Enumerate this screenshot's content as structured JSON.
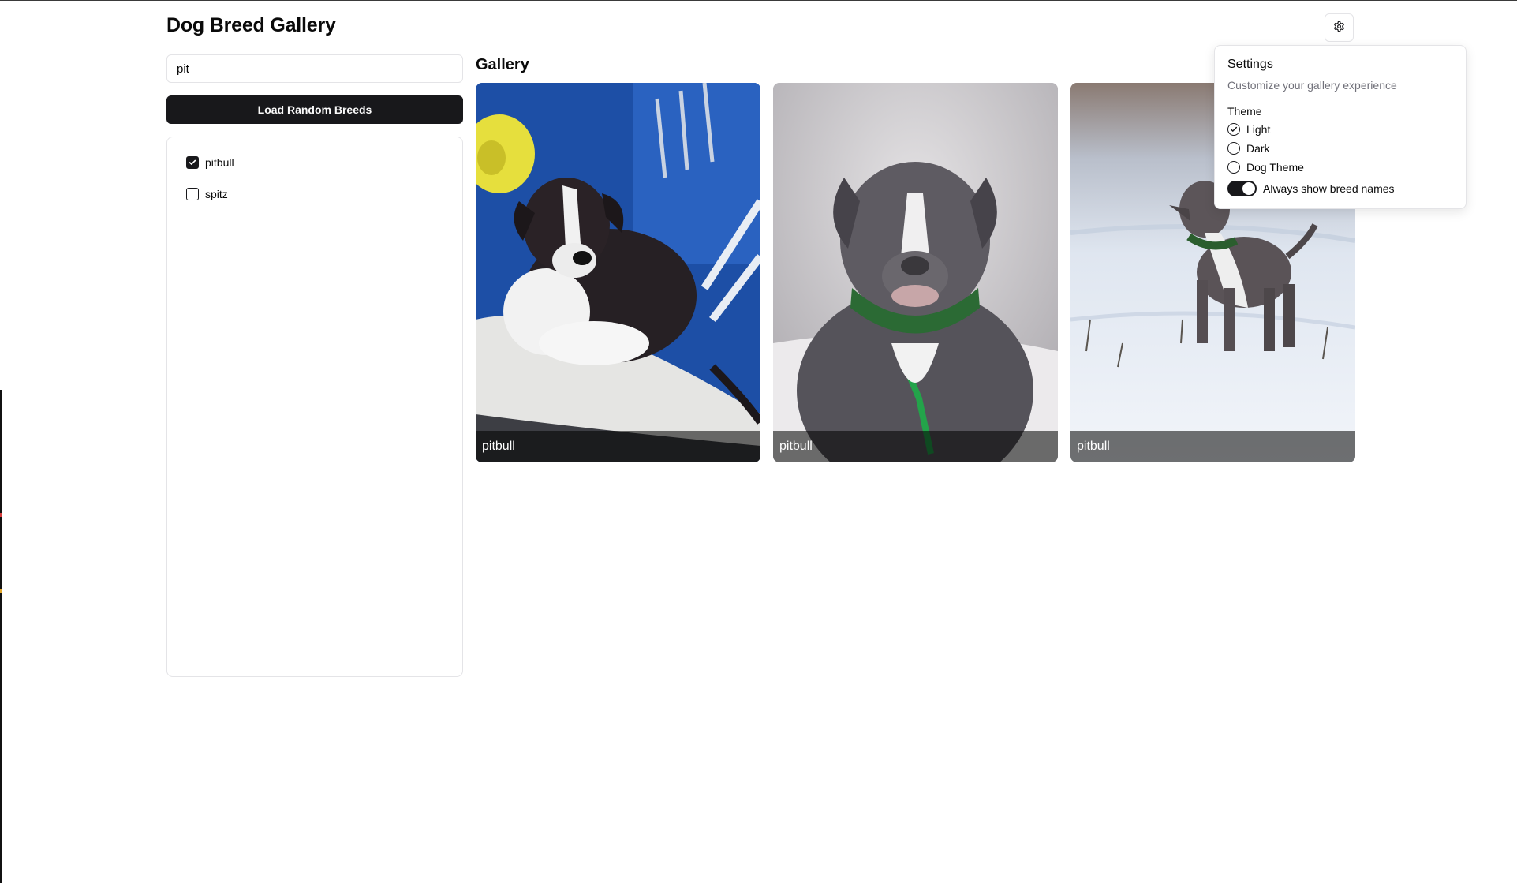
{
  "header": {
    "title": "Dog Breed Gallery",
    "settings_icon": "gear-icon"
  },
  "sidebar": {
    "search": {
      "value": "pit",
      "placeholder": ""
    },
    "load_button_label": "Load Random Breeds",
    "breeds": [
      {
        "label": "pitbull",
        "checked": true
      },
      {
        "label": "spitz",
        "checked": false
      }
    ]
  },
  "gallery": {
    "title": "Gallery",
    "images": [
      {
        "breed": "pitbull"
      },
      {
        "breed": "pitbull"
      },
      {
        "breed": "pitbull"
      }
    ]
  },
  "settings": {
    "title": "Settings",
    "description": "Customize your gallery experience",
    "theme_label": "Theme",
    "theme_options": [
      {
        "label": "Light",
        "selected": true
      },
      {
        "label": "Dark",
        "selected": false
      },
      {
        "label": "Dog Theme",
        "selected": false
      }
    ],
    "toggle": {
      "label": "Always show breed names",
      "on": true
    }
  }
}
